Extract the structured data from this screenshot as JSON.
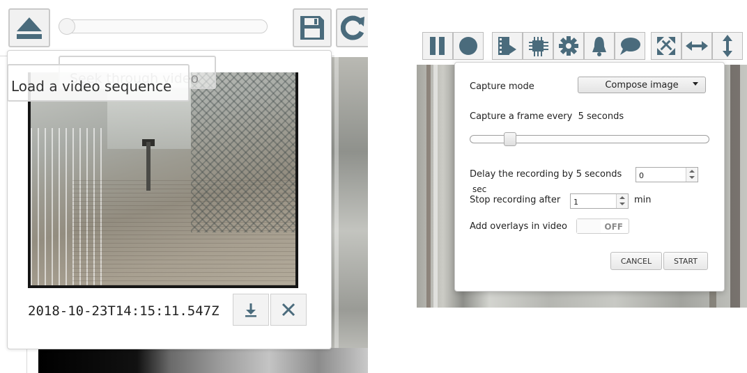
{
  "left": {
    "toolbar": {
      "load_icon": "eject-icon",
      "save_icon": "floppy-disk-icon",
      "refresh_icon": "refresh-icon"
    },
    "tooltips": {
      "seek": "Seek through video",
      "load": "Load a video sequence"
    },
    "clip": {
      "timestamp": "2018-10-23T14:15:11.547Z",
      "download_icon": "download-icon",
      "close_icon": "close-icon"
    }
  },
  "right": {
    "toolbar_icons": [
      "pause-icon",
      "record-icon",
      "film-export-icon",
      "chip-icon",
      "gear-icon",
      "bell-icon",
      "speech-bubble-icon",
      "fullscreen-icon",
      "horizontal-arrows-icon",
      "vertical-arrows-icon"
    ],
    "capture_dialog": {
      "capture_mode_label": "Capture mode",
      "capture_mode_value": "Compose image",
      "frame_interval_label": "Capture a frame every  5 seconds",
      "frame_interval_seconds": 5,
      "delay_label": "Delay the recording by 5 seconds",
      "delay_value": "0",
      "delay_unit": "sec",
      "stop_label": "Stop recording after",
      "stop_value": "1",
      "stop_unit": "min",
      "overlays_label": "Add overlays in video",
      "overlays_state": "OFF",
      "cancel_label": "CANCEL",
      "start_label": "START"
    }
  },
  "colors": {
    "icon_fill": "#4a6b7c",
    "border": "#c9c9c9",
    "button_bg": "#f1f1f1"
  }
}
